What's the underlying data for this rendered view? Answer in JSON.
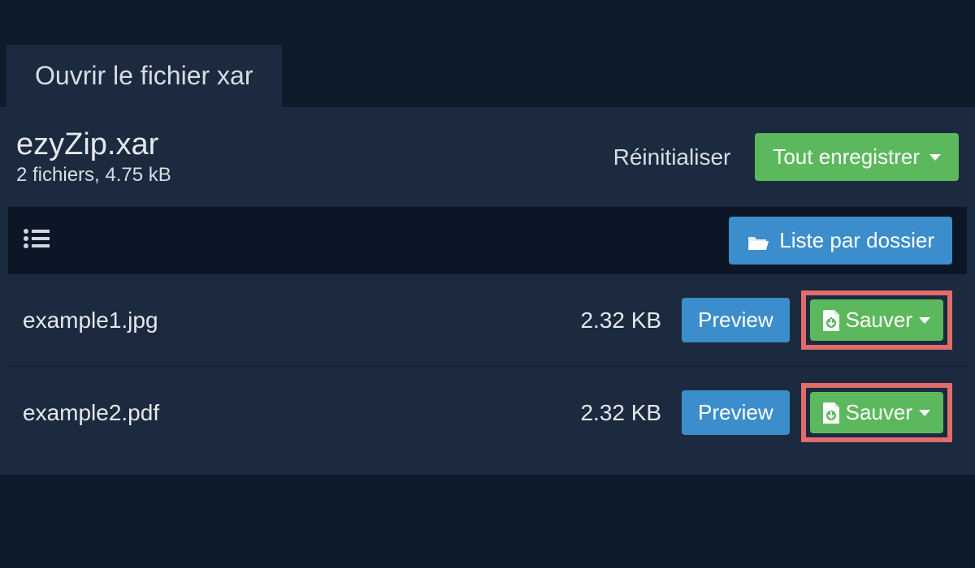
{
  "tab": {
    "label": "Ouvrir le fichier xar"
  },
  "header": {
    "filename": "ezyZip.xar",
    "subline": "2 fichiers, 4.75 kB",
    "reset_label": "Réinitialiser",
    "save_all_label": "Tout enregistrer"
  },
  "toolbar": {
    "folder_list_label": "Liste par dossier"
  },
  "files": [
    {
      "name": "example1.jpg",
      "size": "2.32 KB",
      "preview_label": "Preview",
      "save_label": "Sauver"
    },
    {
      "name": "example2.pdf",
      "size": "2.32 KB",
      "preview_label": "Preview",
      "save_label": "Sauver"
    }
  ]
}
